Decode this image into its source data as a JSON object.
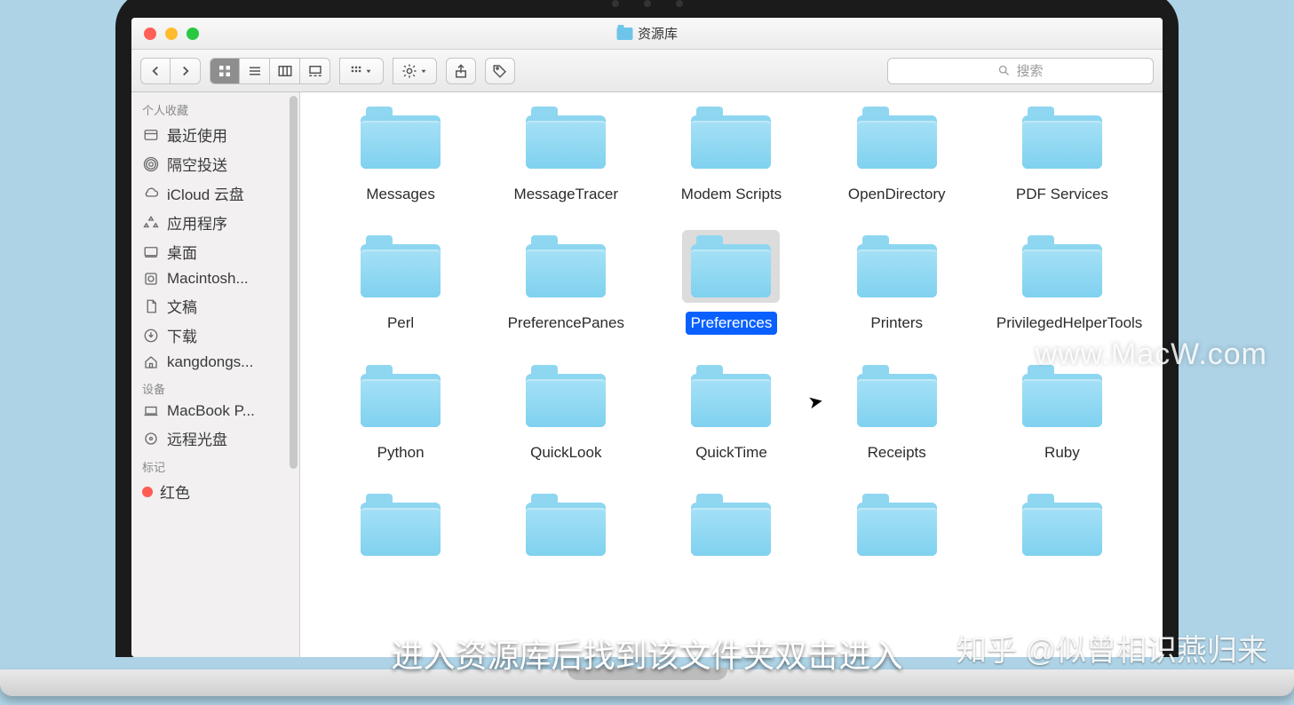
{
  "window": {
    "title": "资源库"
  },
  "search": {
    "placeholder": "搜索"
  },
  "sidebar": {
    "favorites_header": "个人收藏",
    "favorites": [
      {
        "label": "最近使用",
        "icon": "recent"
      },
      {
        "label": "隔空投送",
        "icon": "airdrop"
      },
      {
        "label": "iCloud 云盘",
        "icon": "cloud"
      },
      {
        "label": "应用程序",
        "icon": "apps"
      },
      {
        "label": "桌面",
        "icon": "desktop"
      },
      {
        "label": "Macintosh...",
        "icon": "hdd"
      },
      {
        "label": "文稿",
        "icon": "docs"
      },
      {
        "label": "下载",
        "icon": "download"
      },
      {
        "label": "kangdongs...",
        "icon": "home"
      }
    ],
    "devices_header": "设备",
    "devices": [
      {
        "label": "MacBook P...",
        "icon": "laptop"
      },
      {
        "label": "远程光盘",
        "icon": "disc"
      }
    ],
    "tags_header": "标记",
    "tags": [
      {
        "label": "红色",
        "color": "red"
      }
    ]
  },
  "folders": [
    {
      "name": "Messages",
      "selected": false
    },
    {
      "name": "MessageTracer",
      "selected": false
    },
    {
      "name": "Modem Scripts",
      "selected": false
    },
    {
      "name": "OpenDirectory",
      "selected": false
    },
    {
      "name": "PDF Services",
      "selected": false
    },
    {
      "name": "Perl",
      "selected": false
    },
    {
      "name": "PreferencePanes",
      "selected": false
    },
    {
      "name": "Preferences",
      "selected": true
    },
    {
      "name": "Printers",
      "selected": false
    },
    {
      "name": "PrivilegedHelperTools",
      "selected": false
    },
    {
      "name": "Python",
      "selected": false
    },
    {
      "name": "QuickLook",
      "selected": false
    },
    {
      "name": "QuickTime",
      "selected": false
    },
    {
      "name": "Receipts",
      "selected": false
    },
    {
      "name": "Ruby",
      "selected": false
    },
    {
      "name": "",
      "selected": false
    },
    {
      "name": "",
      "selected": false
    },
    {
      "name": "",
      "selected": false
    },
    {
      "name": "",
      "selected": false
    },
    {
      "name": "",
      "selected": false
    }
  ],
  "caption": "进入资源库后找到该文件夹双击进入",
  "watermark1": "www.MacW.com",
  "watermark2": "知乎 @似曾相识燕归来"
}
